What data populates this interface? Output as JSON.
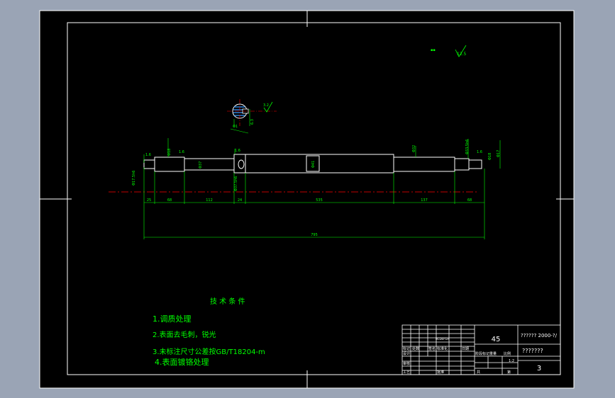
{
  "colors": {
    "background": "#9aa4b5",
    "paper": "#000000",
    "outline": "#ffffff",
    "dimension": "#00ff00",
    "centerline": "#ff0000",
    "hatch": "#3399ff",
    "text_white": "#ffffff"
  },
  "drawing": {
    "roughness_top": "12.5",
    "section_roughness": "3.2",
    "section_labels": [
      "6.3",
      "Φ1"
    ],
    "shaft_left_labels": [
      "Φ17.5h6",
      "1.6",
      "Φ18",
      "1.6",
      "Φ37",
      "1.6",
      "Φ37.5h6"
    ],
    "shaft_right_labels": [
      "Φ41",
      "Φ32",
      "Φ33.5h6",
      "1.6",
      "Φ18",
      "Φ17"
    ],
    "axial_dims": [
      "25",
      "68",
      "112",
      "24",
      "535",
      "137",
      "68"
    ],
    "overall_length": "795"
  },
  "notes": {
    "title": "技 术 条 件",
    "items": [
      "1.调质处理",
      "2.表面去毛刺，锐光",
      "3.未标注尺寸公差按GB/T18204-m",
      "4.表面镀铬处理"
    ]
  },
  "title_block": {
    "material": "45",
    "drawing_code": "?????? 2000-?/",
    "part_name": "???????",
    "scale": "1:2",
    "sheet": "3",
    "mark_label": "标记",
    "count_label": "处数",
    "revision_label": "BCDEFGH",
    "design_label": "设计",
    "check_label": "审核",
    "process_label": "工艺",
    "stage_label": "阶段标记",
    "weight_label": "重量",
    "ratio_label": "比例",
    "total_label": "共",
    "page_label": "第",
    "standard_label": "标准化",
    "approve_label": "批准",
    "date_label": "日期",
    "sign_label": "签名"
  }
}
